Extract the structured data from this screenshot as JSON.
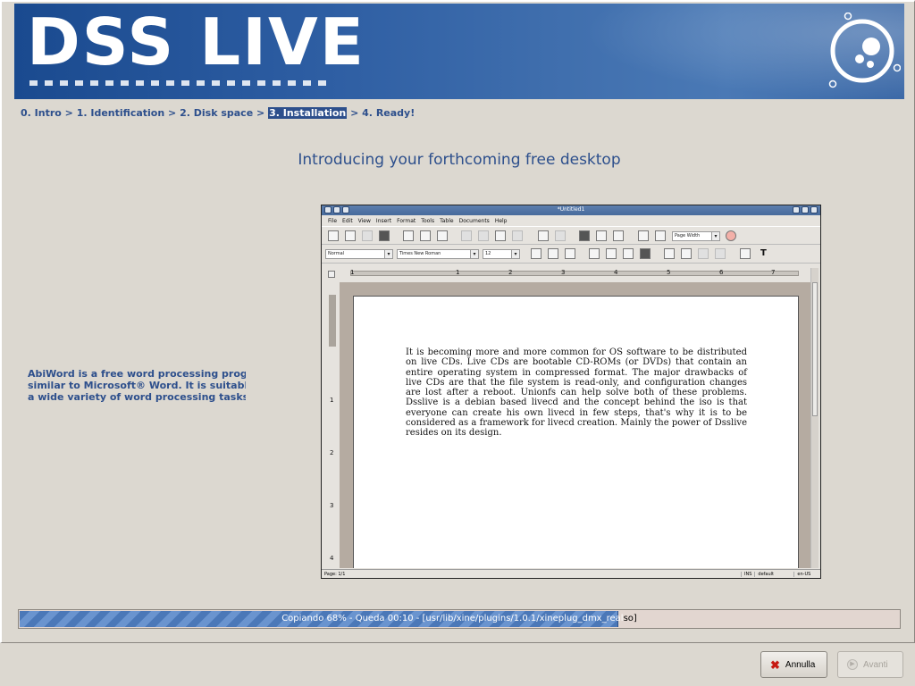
{
  "banner": {
    "title": "DSS LIVE"
  },
  "breadcrumb": [
    {
      "label": "0. Intro",
      "active": false
    },
    {
      "label": " > ",
      "sep": true
    },
    {
      "label": "1. Identification",
      "active": false
    },
    {
      "label": " > ",
      "sep": true
    },
    {
      "label": "2. Disk space",
      "active": false
    },
    {
      "label": " > ",
      "sep": true
    },
    {
      "label": "3. Installation",
      "active": true
    },
    {
      "label": " > ",
      "sep": true
    },
    {
      "label": "4. Ready!",
      "active": false
    }
  ],
  "headline": "Introducing your forthcoming free desktop",
  "description": {
    "line1": "AbiWord is a free word processing progran",
    "line2": "similar to Microsoft® Word. It is suitable fo",
    "line3": "a wide variety of word processing tasks."
  },
  "abiword": {
    "window_title": "*Untitled1",
    "menu": [
      "File",
      "Edit",
      "View",
      "Insert",
      "Format",
      "Tools",
      "Table",
      "Documents",
      "Help"
    ],
    "zoom": "Page Width",
    "style": "Normal",
    "font": "Times New Roman",
    "size": "12",
    "ruler_h": [
      "1",
      "1",
      "2",
      "3",
      "4",
      "5",
      "6",
      "7"
    ],
    "ruler_v": [
      "1",
      "2",
      "3",
      "4"
    ],
    "body_text": "It is becoming more and more common for OS software to be distributed on live CDs. Live CDs are bootable CD-ROMs (or DVDs) that contain an entire operating system in compressed format. The major drawbacks of live CDs are that the file system is read-only, and configuration changes are lost after a reboot. Unionfs can help solve both of these problems. Dsslive is a debian based livecd and the concept behind the iso is that everyone can create his own livecd in few steps, that's why it is to be considered as a framework for livecd creation. Mainly the power of Dsslive resides on its design.",
    "status_page": "Page: 1/1",
    "status_ins": "INS",
    "status_default": "default",
    "status_lang": "en-US"
  },
  "progress": {
    "text_left": "Copiando 68% - Queda 00:10 - [usr/lib/xine/plugins/1.0.1/xineplug_dmx_real",
    "text_right": "so]",
    "percent": 68
  },
  "buttons": {
    "cancel": "Annulla",
    "next": "Avanti"
  },
  "colors": {
    "accent": "#2d4f8c",
    "banner": "#2e5ea3",
    "cancel_icon": "#c71a12"
  },
  "icons": {
    "cancel": "close-icon",
    "next": "forward-arrow-icon",
    "logo": "dsslive-logo-icon"
  }
}
